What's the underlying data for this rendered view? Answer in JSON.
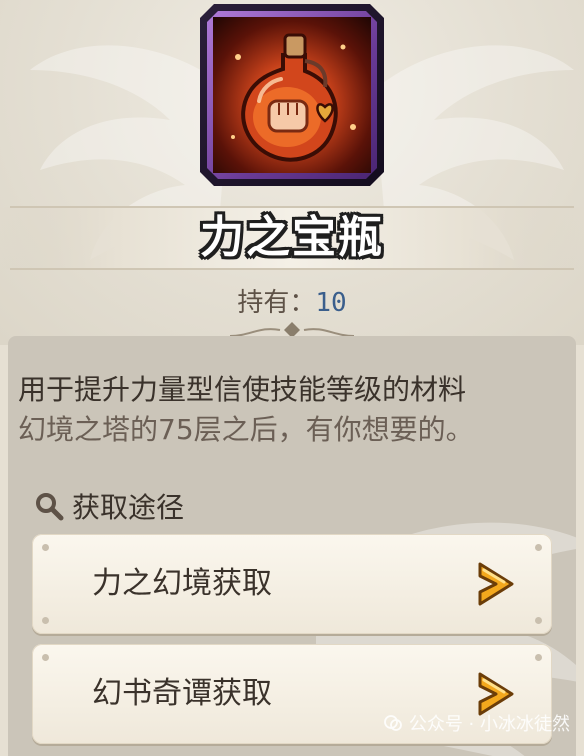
{
  "item": {
    "name": "力之宝瓶",
    "owned_label": "持有：",
    "owned_count": "10",
    "rarity_color": "#8b4fc0"
  },
  "description": {
    "line1": "用于提升力量型信使技能等级的材料",
    "line2": "幻境之塔的75层之后，有你想要的。"
  },
  "sources": {
    "header": "获取途径",
    "items": [
      {
        "label": "力之幻境获取",
        "icon": "chevron-right-icon"
      },
      {
        "label": "幻书奇谭获取",
        "icon": "chevron-right-icon"
      }
    ]
  },
  "watermark": {
    "text": "公众号 · 小冰冰徒然"
  },
  "colors": {
    "panel": "#cbc5b9",
    "accent_arrow": "#f0a51c",
    "count_blue": "#3a5e8c"
  }
}
